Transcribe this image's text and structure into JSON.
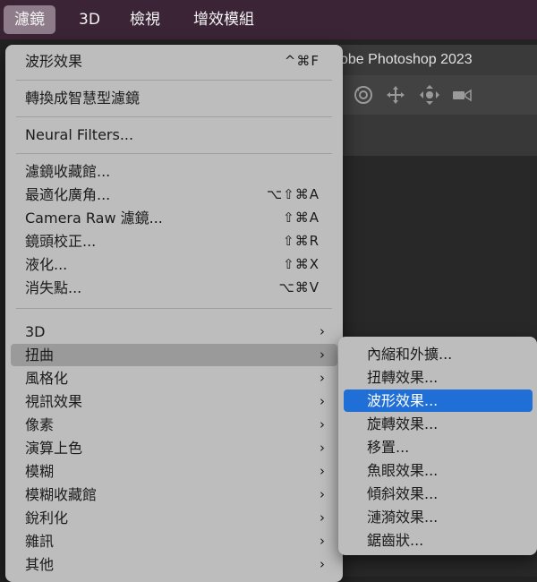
{
  "menubar": {
    "items": [
      {
        "label": "濾鏡",
        "active": true
      },
      {
        "label": "3D",
        "active": false
      },
      {
        "label": "檢視",
        "active": false
      },
      {
        "label": "增效模組",
        "active": false
      }
    ]
  },
  "app": {
    "title": "obe Photoshop 2023",
    "toolbar_icons": [
      "rotate-3d-icon",
      "pan-3d-icon",
      "slide-3d-icon",
      "camera-3d-icon"
    ]
  },
  "filter_menu": {
    "last_filter": {
      "label": "波形效果",
      "shortcut": "^⌘F"
    },
    "convert_smart": {
      "label": "轉換成智慧型濾鏡"
    },
    "neural": {
      "label": "Neural Filters..."
    },
    "gallery": {
      "label": "濾鏡收藏館..."
    },
    "adaptive_wide": {
      "label": "最適化廣角...",
      "shortcut": "⌥⇧⌘A"
    },
    "camera_raw": {
      "label": "Camera Raw 濾鏡...",
      "shortcut": "⇧⌘A"
    },
    "lens_correction": {
      "label": "鏡頭校正...",
      "shortcut": "⇧⌘R"
    },
    "liquify": {
      "label": "液化...",
      "shortcut": "⇧⌘X"
    },
    "vanishing_point": {
      "label": "消失點...",
      "shortcut": "⌥⌘V"
    },
    "submenus": [
      {
        "label": "3D"
      },
      {
        "label": "扭曲"
      },
      {
        "label": "風格化"
      },
      {
        "label": "視訊效果"
      },
      {
        "label": "像素"
      },
      {
        "label": "演算上色"
      },
      {
        "label": "模糊"
      },
      {
        "label": "模糊收藏館"
      },
      {
        "label": "銳利化"
      },
      {
        "label": "雜訊"
      },
      {
        "label": "其他"
      }
    ],
    "chevron": "›"
  },
  "distort_submenu": {
    "items": [
      {
        "label": "內縮和外擴..."
      },
      {
        "label": "扭轉效果..."
      },
      {
        "label": "波形效果..."
      },
      {
        "label": "旋轉效果..."
      },
      {
        "label": "移置..."
      },
      {
        "label": "魚眼效果..."
      },
      {
        "label": "傾斜效果..."
      },
      {
        "label": "漣漪效果..."
      },
      {
        "label": "鋸齒狀..."
      }
    ],
    "selected": "波形效果..."
  },
  "colors": {
    "menubar_bg": "#3b2436",
    "menu_bg": "#bdbdbd",
    "highlight": "#9a9a9a",
    "selection": "#1f6fd6"
  }
}
